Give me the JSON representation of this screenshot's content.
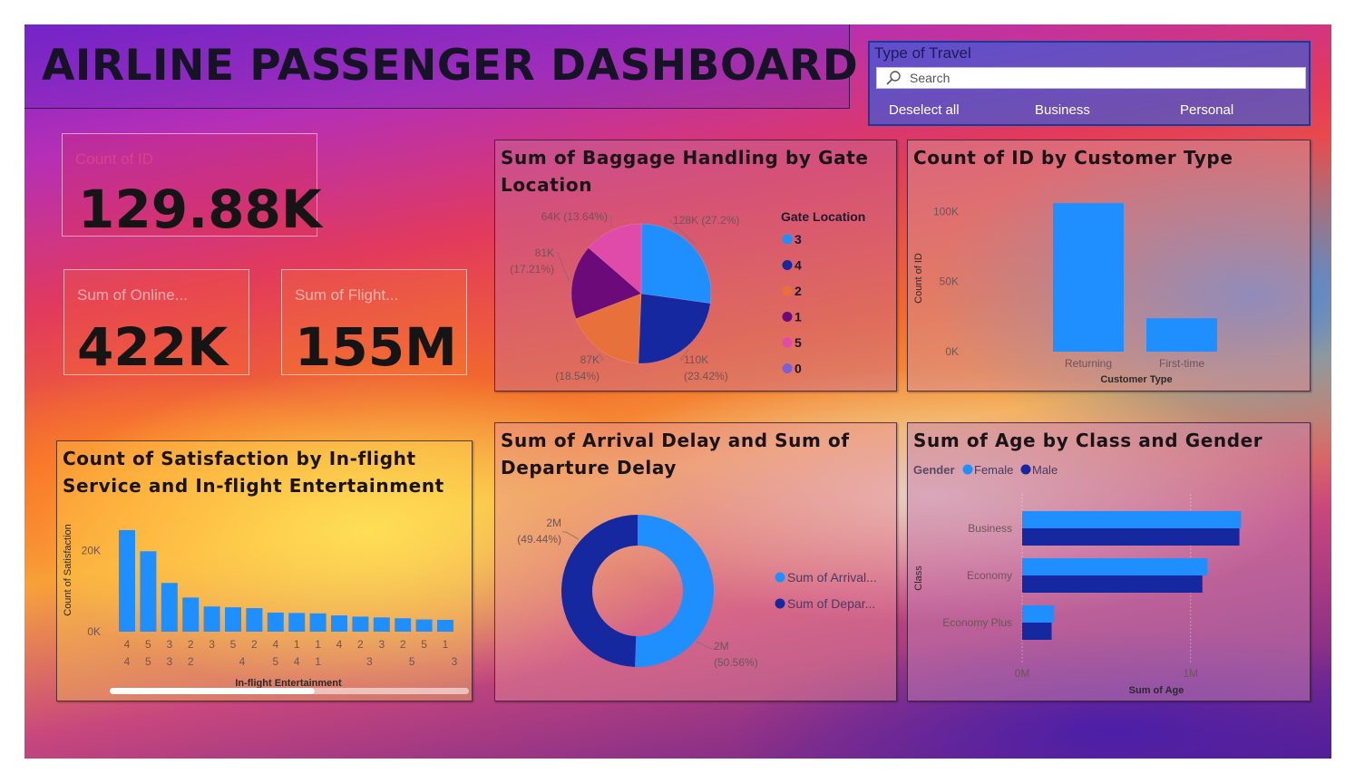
{
  "header": {
    "title": "AIRLINE PASSENGER DASHBOARD"
  },
  "slicer": {
    "title": "Type of Travel",
    "search_placeholder": "Search",
    "options": [
      "Deselect all",
      "Business",
      "Personal"
    ]
  },
  "kpis": {
    "count_id": {
      "label": "Count of ID",
      "value": "129.88K"
    },
    "online": {
      "label": "Sum of Online...",
      "value": "422K"
    },
    "flight": {
      "label": "Sum of Flight...",
      "value": "155M"
    }
  },
  "colors": {
    "blue": "#1f8fff",
    "navy": "#1528a0",
    "orange": "#e8703a",
    "purple": "#6b0a78",
    "pink": "#e04aa8",
    "violet": "#7c5fd6"
  },
  "chart_data": [
    {
      "id": "baggage",
      "type": "pie",
      "title": "Sum of Baggage Handling by Gate Location",
      "legend_title": "Gate Location",
      "legend_position": "right",
      "legend_order": [
        "3",
        "4",
        "2",
        "1",
        "5",
        "0"
      ],
      "slices": [
        {
          "name": "3",
          "value": 128,
          "value_label": "128K",
          "pct_label": "(27.2%)",
          "color": "#1f8fff"
        },
        {
          "name": "4",
          "value": 110,
          "value_label": "110K",
          "pct_label": "(23.42%)",
          "color": "#1528a0"
        },
        {
          "name": "2",
          "value": 87,
          "value_label": "87K",
          "pct_label": "(18.54%)",
          "color": "#e8703a"
        },
        {
          "name": "1",
          "value": 81,
          "value_label": "81K",
          "pct_label": "(17.21%)",
          "color": "#6b0a78"
        },
        {
          "name": "5",
          "value": 64,
          "value_label": "64K",
          "pct_label": "(13.64%)",
          "color": "#e04aa8"
        },
        {
          "name": "0",
          "value": 0,
          "value_label": "",
          "pct_label": "",
          "color": "#7c5fd6"
        }
      ]
    },
    {
      "id": "customer",
      "type": "bar",
      "title": "Count of ID by Customer Type",
      "xlabel": "Customer Type",
      "ylabel": "Count of ID",
      "categories": [
        "Returning",
        "First-time"
      ],
      "values": [
        106000,
        23800
      ],
      "yticks": [
        {
          "v": 0,
          "label": "0K"
        },
        {
          "v": 50000,
          "label": "50K"
        },
        {
          "v": 100000,
          "label": "100K"
        }
      ],
      "ylim": [
        0,
        110000
      ],
      "grid": false
    },
    {
      "id": "delay",
      "type": "pie",
      "title": "Sum of Arrival Delay and Sum of Departure Delay",
      "legend_position": "right",
      "slices": [
        {
          "name": "Sum of Arrival...",
          "value": 50.56,
          "value_label": "2M",
          "pct_label": "(50.56%)",
          "color": "#1f8fff"
        },
        {
          "name": "Sum of Depar...",
          "value": 49.44,
          "value_label": "2M",
          "pct_label": "(49.44%)",
          "color": "#1528a0"
        }
      ]
    },
    {
      "id": "age",
      "type": "bar",
      "orientation": "horizontal",
      "title": "Sum of Age by Class and Gender",
      "legend_title": "Gender",
      "legend_position": "top-left",
      "xlabel": "Sum of Age",
      "ylabel": "Class",
      "categories": [
        "Business",
        "Economy",
        "Economy Plus"
      ],
      "series": [
        {
          "name": "Female",
          "values": [
            1300000,
            1100000,
            190000
          ],
          "color": "#1f8fff"
        },
        {
          "name": "Male",
          "values": [
            1290000,
            1070000,
            175000
          ],
          "color": "#1528a0"
        }
      ],
      "xticks": [
        {
          "v": 0,
          "label": "0M"
        },
        {
          "v": 1000000,
          "label": "1M"
        }
      ],
      "xlim": [
        0,
        1400000
      ],
      "grid": true
    },
    {
      "id": "satisfaction",
      "type": "bar",
      "title": "Count of Satisfaction by In-flight Service and In-flight Entertainment",
      "xlabel": "In-flight Entertainment",
      "ylabel": "Count of Satisfaction",
      "categories": [
        {
          "service": "4",
          "entertainment": "4"
        },
        {
          "service": "5",
          "entertainment": "5"
        },
        {
          "service": "3",
          "entertainment": "3"
        },
        {
          "service": "2",
          "entertainment": "2"
        },
        {
          "service": "3",
          "entertainment": ""
        },
        {
          "service": "5",
          "entertainment": "4"
        },
        {
          "service": "2",
          "entertainment": ""
        },
        {
          "service": "4",
          "entertainment": "5"
        },
        {
          "service": "1",
          "entertainment": "4"
        },
        {
          "service": "1",
          "entertainment": "1"
        },
        {
          "service": "4",
          "entertainment": ""
        },
        {
          "service": "2",
          "entertainment": "3"
        },
        {
          "service": "3",
          "entertainment": ""
        },
        {
          "service": "2",
          "entertainment": "5"
        },
        {
          "service": "5",
          "entertainment": ""
        },
        {
          "service": "1",
          "entertainment": "3"
        }
      ],
      "values": [
        25000,
        19800,
        12000,
        8400,
        6200,
        6000,
        5800,
        4700,
        4600,
        4500,
        4000,
        3700,
        3500,
        3300,
        3000,
        2900
      ],
      "yticks": [
        {
          "v": 0,
          "label": "0K"
        },
        {
          "v": 20000,
          "label": "20K"
        }
      ],
      "ylim": [
        0,
        25000
      ],
      "grid": false
    }
  ]
}
